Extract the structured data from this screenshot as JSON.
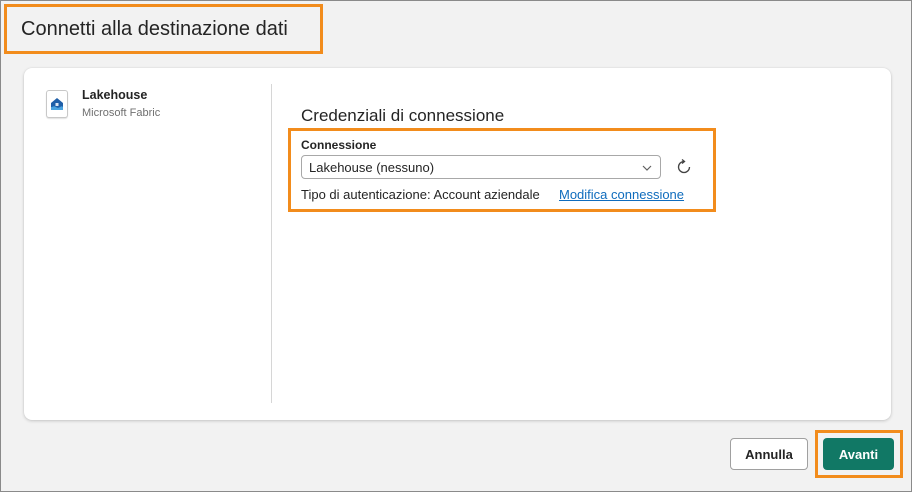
{
  "dialog": {
    "title": "Connetti alla destinazione dati"
  },
  "left_pane": {
    "item": {
      "icon": "lakehouse-icon",
      "name": "Lakehouse",
      "subtitle": "Microsoft Fabric"
    }
  },
  "credentials": {
    "section_title": "Credenziali di connessione",
    "connection_label": "Connessione",
    "connection_value": "Lakehouse (nessuno)",
    "auth_text": "Tipo di autenticazione: Account aziendale",
    "modify_link": "Modifica connessione"
  },
  "footer": {
    "cancel_label": "Annulla",
    "next_label": "Avanti"
  },
  "colors": {
    "highlight": "#f28c1c",
    "primary": "#117865",
    "link": "#0f6cbd"
  }
}
